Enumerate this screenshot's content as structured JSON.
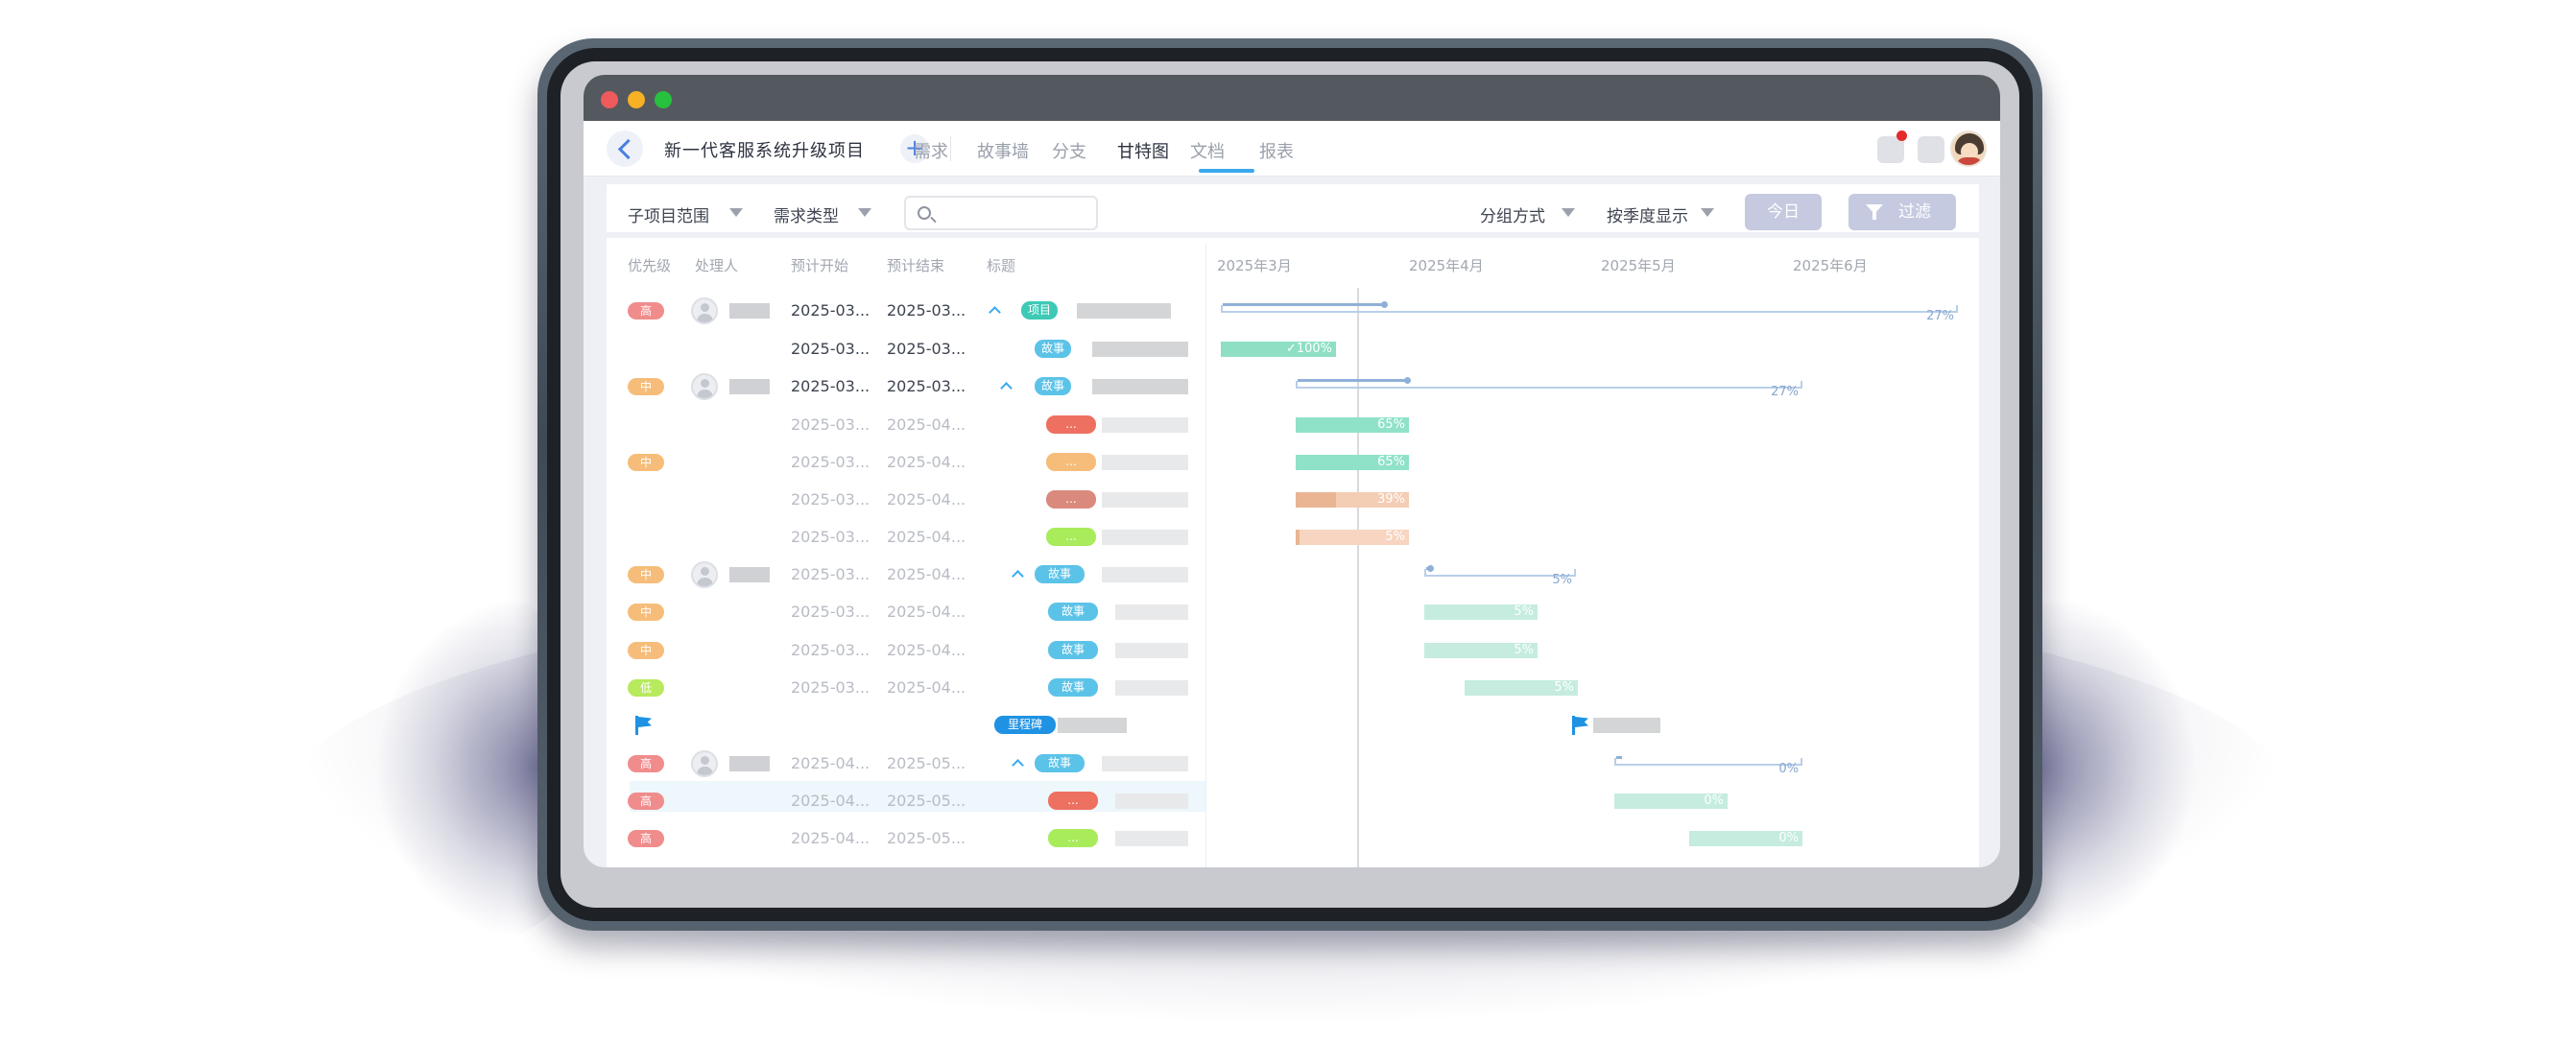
{
  "window": {
    "project_title": "新一代客服系统升级项目",
    "add_symbol": "+",
    "tabs": [
      {
        "label": "需求",
        "active": false
      },
      {
        "label": "故事墙",
        "active": false
      },
      {
        "label": "分支",
        "active": false
      },
      {
        "label": "甘特图",
        "active": true
      },
      {
        "label": "文档",
        "active": false
      },
      {
        "label": "报表",
        "active": false
      }
    ],
    "accent_color": "#3aa9ef"
  },
  "filters": {
    "subproject_scope": "子项目范围",
    "requirement_type": "需求类型",
    "search_placeholder": "",
    "group_by": "分组方式",
    "display_by": "按季度显示",
    "today_button": "今日",
    "filter_button": "过滤"
  },
  "table_headers": {
    "priority": "优先级",
    "assignee": "处理人",
    "planned_start": "预计开始",
    "planned_end": "预计结束",
    "title": "标题"
  },
  "months": [
    "2025年3月",
    "2025年4月",
    "2025年5月",
    "2025年6月"
  ],
  "rows": [
    {
      "priority": "高",
      "priority_color": "#f08c8c",
      "assignee": true,
      "start": "2025-03...",
      "end": "2025-03...",
      "expand": true,
      "tag": "项目",
      "tag_color": "#3ec9b6",
      "muted": false,
      "bar_type": "track",
      "progress": "27%"
    },
    {
      "priority": "",
      "assignee": false,
      "start": "2025-03...",
      "end": "2025-03...",
      "expand": false,
      "tag": "故事",
      "tag_color": "#5cc3e8",
      "muted": false,
      "bar_type": "bar",
      "progress": "✓100%",
      "bar_color": "#8edfc4"
    },
    {
      "priority": "中",
      "priority_color": "#f6bd7a",
      "assignee": true,
      "start": "2025-03...",
      "end": "2025-03...",
      "expand": true,
      "tag": "故事",
      "tag_color": "#5cc3e8",
      "muted": false,
      "bar_type": "track",
      "progress": "27%"
    },
    {
      "priority": "",
      "assignee": false,
      "start": "2025-03...",
      "end": "2025-04...",
      "expand": false,
      "tag": "...",
      "tag_color": "#ee7060",
      "muted": true,
      "bar_type": "bar",
      "progress": "65%",
      "bar_color": "#8fe2c8"
    },
    {
      "priority": "中",
      "priority_color": "#f6bd7a",
      "assignee": false,
      "start": "2025-03...",
      "end": "2025-04...",
      "expand": false,
      "tag": "...",
      "tag_color": "#f6bd7a",
      "muted": true,
      "bar_type": "bar",
      "progress": "65%",
      "bar_color": "#8fe2c8"
    },
    {
      "priority": "",
      "assignee": false,
      "start": "2025-03...",
      "end": "2025-04...",
      "expand": false,
      "tag": "...",
      "tag_color": "#d98a7c",
      "muted": true,
      "bar_type": "bar",
      "progress": "39%",
      "bar_color": "#f4cdb5"
    },
    {
      "priority": "",
      "assignee": false,
      "start": "2025-03...",
      "end": "2025-04...",
      "expand": false,
      "tag": "...",
      "tag_color": "#a8ec5c",
      "muted": true,
      "bar_type": "bar",
      "progress": "5%",
      "bar_color": "#f7d5c0"
    },
    {
      "priority": "中",
      "priority_color": "#f6bd7a",
      "assignee": true,
      "start": "2025-03...",
      "end": "2025-04...",
      "expand": true,
      "tag": "故事",
      "tag_color": "#5cc3e8",
      "muted": true,
      "bar_type": "track",
      "progress": "5%"
    },
    {
      "priority": "中",
      "priority_color": "#f6bd7a",
      "assignee": false,
      "start": "2025-03...",
      "end": "2025-04...",
      "expand": false,
      "tag": "故事",
      "tag_color": "#5cc3e8",
      "muted": true,
      "bar_type": "bar",
      "progress": "5%",
      "bar_color": "#c5ecdf"
    },
    {
      "priority": "中",
      "priority_color": "#f6bd7a",
      "assignee": false,
      "start": "2025-03...",
      "end": "2025-04...",
      "expand": false,
      "tag": "故事",
      "tag_color": "#5cc3e8",
      "muted": true,
      "bar_type": "bar",
      "progress": "5%",
      "bar_color": "#c5ecdf"
    },
    {
      "priority": "低",
      "priority_color": "#b7ea5c",
      "assignee": false,
      "start": "2025-03...",
      "end": "2025-04...",
      "expand": false,
      "tag": "故事",
      "tag_color": "#5cc3e8",
      "muted": true,
      "bar_type": "bar",
      "progress": "5%",
      "bar_color": "#c5ecdf"
    },
    {
      "milestone": true,
      "tag": "里程碑",
      "tag_color": "#1f92e4"
    },
    {
      "priority": "高",
      "priority_color": "#f08c8c",
      "assignee": true,
      "start": "2025-04...",
      "end": "2025-05...",
      "expand": true,
      "tag": "故事",
      "tag_color": "#5cc3e8",
      "muted": true,
      "bar_type": "track",
      "progress": "0%"
    },
    {
      "priority": "高",
      "priority_color": "#f08c8c",
      "assignee": false,
      "start": "2025-04...",
      "end": "2025-05...",
      "expand": false,
      "tag": "...",
      "tag_color": "#ee7060",
      "muted": true,
      "bar_type": "bar",
      "progress": "0%",
      "bar_color": "#c5ecdf"
    },
    {
      "priority": "高",
      "priority_color": "#f08c8c",
      "assignee": false,
      "start": "2025-04...",
      "end": "2025-05...",
      "expand": false,
      "tag": "...",
      "tag_color": "#a8ec5c",
      "muted": true,
      "bar_type": "bar",
      "progress": "0%",
      "bar_color": "#c5ecdf"
    }
  ]
}
